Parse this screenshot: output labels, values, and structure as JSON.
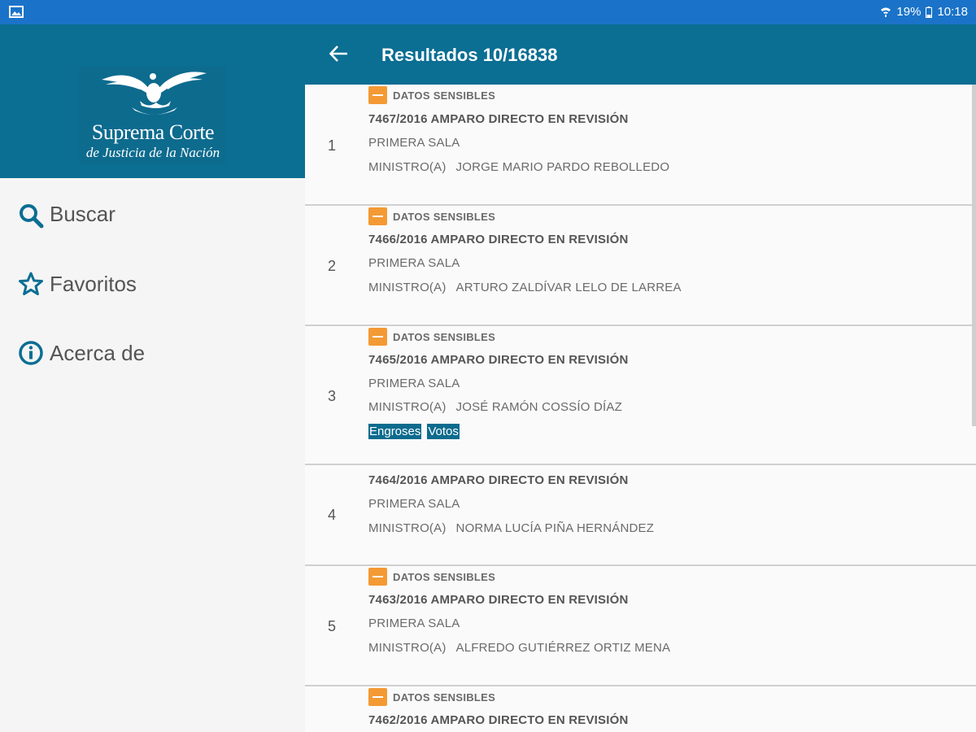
{
  "status_bar": {
    "battery": "19%",
    "time": "10:18"
  },
  "sidebar": {
    "logo": {
      "line1": "Suprema Corte",
      "line2": "de Justicia de la Nación"
    },
    "items": [
      {
        "label": "Buscar",
        "icon": "search-icon"
      },
      {
        "label": "Favoritos",
        "icon": "star-icon"
      },
      {
        "label": "Acerca de",
        "icon": "info-icon"
      }
    ]
  },
  "appbar": {
    "title": "Resultados 10/16838"
  },
  "results": [
    {
      "num": "1",
      "badge": "DATOS SENSIBLES",
      "case": "7467/2016  AMPARO DIRECTO EN REVISIÓN",
      "sala": "PRIMERA SALA",
      "ministro_label": "MINISTRO(A)",
      "ministro": "JORGE MARIO PARDO REBOLLEDO"
    },
    {
      "num": "2",
      "badge": "DATOS SENSIBLES",
      "case": "7466/2016  AMPARO DIRECTO EN REVISIÓN",
      "sala": "PRIMERA SALA",
      "ministro_label": "MINISTRO(A)",
      "ministro": "ARTURO ZALDÍVAR LELO DE LARREA"
    },
    {
      "num": "3",
      "badge": "DATOS SENSIBLES",
      "case": "7465/2016  AMPARO DIRECTO EN REVISIÓN",
      "sala": "PRIMERA SALA",
      "ministro_label": "MINISTRO(A)",
      "ministro": "JOSÉ RAMÓN COSSÍO DÍAZ",
      "tags": [
        "Engroses",
        "Votos"
      ]
    },
    {
      "num": "4",
      "case": "7464/2016  AMPARO DIRECTO EN REVISIÓN",
      "sala": "PRIMERA SALA",
      "ministro_label": "MINISTRO(A)",
      "ministro": "NORMA LUCÍA PIÑA HERNÁNDEZ"
    },
    {
      "num": "5",
      "badge": "DATOS SENSIBLES",
      "case": "7463/2016  AMPARO DIRECTO EN REVISIÓN",
      "sala": "PRIMERA SALA",
      "ministro_label": "MINISTRO(A)",
      "ministro": "ALFREDO GUTIÉRREZ ORTIZ MENA"
    },
    {
      "badge": "DATOS SENSIBLES",
      "case": "7462/2016  AMPARO DIRECTO EN REVISIÓN"
    }
  ]
}
